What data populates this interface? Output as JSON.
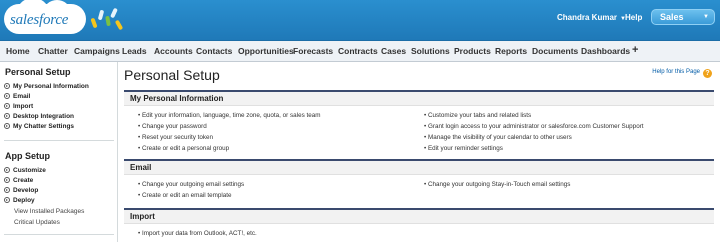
{
  "header": {
    "logo_text": "salesforce",
    "user_name": "Chandra Kumar",
    "help": "Help",
    "app": "Sales",
    "colors": {
      "bar": "#1f79b8",
      "app_switcher": "#3a9bd8"
    }
  },
  "tabs": [
    "Home",
    "Chatter",
    "Campaigns",
    "Leads",
    "Accounts",
    "Contacts",
    "Opportunities",
    "Forecasts",
    "Contracts",
    "Cases",
    "Solutions",
    "Products",
    "Reports",
    "Documents",
    "Dashboards"
  ],
  "tabs_plus": "+",
  "sidebar": {
    "personal_title": "Personal Setup",
    "personal_items": [
      "My Personal Information",
      "Email",
      "Import",
      "Desktop Integration",
      "My Chatter Settings"
    ],
    "app_title": "App Setup",
    "app_items": [
      "Customize",
      "Create",
      "Develop",
      "Deploy"
    ],
    "app_subitems": [
      "View Installed Packages",
      "Critical Updates"
    ]
  },
  "main": {
    "title": "Personal Setup",
    "help_page": "Help for this Page",
    "sections": [
      {
        "title": "My Personal Information",
        "left": [
          "• Edit your information, language, time zone, quota, or sales team",
          "• Change your password",
          "• Reset your security token",
          "• Create or edit a personal group"
        ],
        "right": [
          "• Customize your tabs and related lists",
          "• Grant login access to your administrator or salesforce.com Customer Support",
          "• Manage the visibility of your calendar to other users",
          "• Edit your reminder settings"
        ]
      },
      {
        "title": "Email",
        "left": [
          "• Change your outgoing email settings",
          "• Create or edit an email template"
        ],
        "right": [
          "• Change your outgoing Stay-in-Touch email settings"
        ]
      },
      {
        "title": "Import",
        "left": [
          "• Import your data from Outlook, ACT!, etc."
        ],
        "right": []
      }
    ]
  }
}
